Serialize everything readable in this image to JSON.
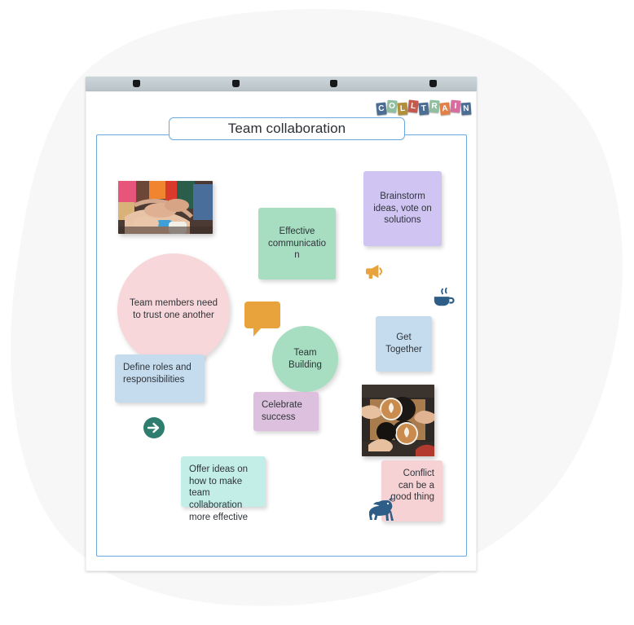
{
  "app": {
    "brand_name": "COLLTRAIN",
    "brand_tiles": [
      {
        "ch": "C",
        "bg": "#4d6e94",
        "tilt": "down"
      },
      {
        "ch": "O",
        "bg": "#8fbea0",
        "tilt": "up"
      },
      {
        "ch": "L",
        "bg": "#b28f3a",
        "tilt": "down"
      },
      {
        "ch": "L",
        "bg": "#c45a4f",
        "tilt": "up"
      },
      {
        "ch": "T",
        "bg": "#4d6e94",
        "tilt": "down"
      },
      {
        "ch": "R",
        "bg": "#8fbea0",
        "tilt": "up"
      },
      {
        "ch": "A",
        "bg": "#e2804a",
        "tilt": "down"
      },
      {
        "ch": "I",
        "bg": "#d76f9e",
        "tilt": "up"
      },
      {
        "ch": "N",
        "bg": "#4d6e94",
        "tilt": "down"
      }
    ]
  },
  "flipchart": {
    "clamp_clip_count": 4,
    "board_title": "Team collaboration"
  },
  "canvas": {
    "notes": [
      {
        "id": "effective-communication",
        "text": "Effective communication",
        "color": "#a7ddc0",
        "align": "center"
      },
      {
        "id": "brainstorm-ideas",
        "text": "Brainstorm ideas, vote on solutions",
        "color": "#cfc4f2",
        "align": "center"
      },
      {
        "id": "define-roles",
        "text": "Define roles and responsibilities",
        "color": "#c5dcef",
        "align": "topleft"
      },
      {
        "id": "get-together",
        "text": "Get Together",
        "color": "#c5dcef",
        "align": "center"
      },
      {
        "id": "celebrate-success",
        "text": "Celebrate success",
        "color": "#ddc0dd",
        "align": "topleft"
      },
      {
        "id": "offer-ideas",
        "text": "Offer ideas on how to make team collaboration more effective",
        "color": "#c3eee8",
        "align": "topleft"
      },
      {
        "id": "conflict-good",
        "text": "Conflict can be a good thing",
        "color": "#f6d2d4",
        "align": "topright"
      }
    ],
    "circles": [
      {
        "id": "team-trust",
        "text": "Team members need to trust one another",
        "color": "#f7d7d9"
      },
      {
        "id": "team-building",
        "text": "Team Building",
        "color": "#a7ddc0"
      }
    ],
    "photos": [
      {
        "id": "hands-together-photo",
        "alt": "Team hands stacked together"
      },
      {
        "id": "coffee-cheers-photo",
        "alt": "Hands holding latte coffee cups"
      }
    ],
    "icons": [
      {
        "id": "megaphone-icon",
        "color": "#e9a33c"
      },
      {
        "id": "coffee-cup-icon",
        "color": "#2e5d87"
      },
      {
        "id": "speech-bubble-icon",
        "color": "#e9a33c"
      },
      {
        "id": "arrow-right-circle-icon",
        "color": "#2f7d6e"
      },
      {
        "id": "unicorn-icon",
        "color": "#2e5d87"
      }
    ]
  },
  "colors": {
    "accent_blue": "#6aa9e0",
    "blob_gray": "#f7f7f7",
    "clamp_gray": "#c2cbd0",
    "text_dark": "#2e343a"
  }
}
